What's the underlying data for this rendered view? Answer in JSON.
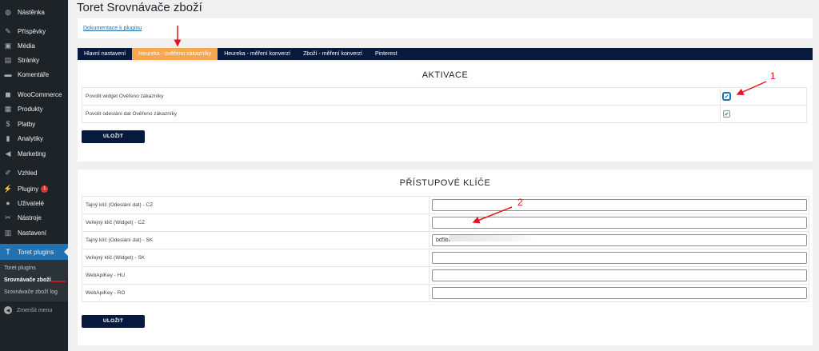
{
  "sidebar": {
    "items": [
      {
        "label": "Nástěnka",
        "icon": "dashboard-icon",
        "glyph": "◍"
      },
      {
        "label": "Příspěvky",
        "icon": "pin-icon",
        "glyph": "✎"
      },
      {
        "label": "Média",
        "icon": "media-icon",
        "glyph": "▣"
      },
      {
        "label": "Stránky",
        "icon": "pages-icon",
        "glyph": "▤"
      },
      {
        "label": "Komentáře",
        "icon": "comments-icon",
        "glyph": "▬"
      },
      {
        "label": "WooCommerce",
        "icon": "woocommerce-icon",
        "glyph": "◼"
      },
      {
        "label": "Produkty",
        "icon": "products-icon",
        "glyph": "▦"
      },
      {
        "label": "Platby",
        "icon": "payments-icon",
        "glyph": "$"
      },
      {
        "label": "Analytiky",
        "icon": "analytics-icon",
        "glyph": "▮"
      },
      {
        "label": "Marketing",
        "icon": "marketing-icon",
        "glyph": "◀"
      },
      {
        "label": "Vzhled",
        "icon": "appearance-icon",
        "glyph": "✐"
      },
      {
        "label": "Pluginy",
        "icon": "plugins-icon",
        "glyph": "⚡",
        "badge": "1"
      },
      {
        "label": "Uživatelé",
        "icon": "users-icon",
        "glyph": "●"
      },
      {
        "label": "Nástroje",
        "icon": "tools-icon",
        "glyph": "✂"
      },
      {
        "label": "Nastavení",
        "icon": "settings-icon",
        "glyph": "▥"
      },
      {
        "label": "Toret plugins",
        "icon": "toret-icon",
        "glyph": "T"
      }
    ],
    "submenu": [
      "Toret plugins",
      "Srovnávače zboží",
      "Srovnávače zboží log"
    ],
    "collapse": "Zmenšit menu"
  },
  "page": {
    "title": "Toret Srovnávače zboží",
    "doc_link": "Dokumentace k pluginu"
  },
  "tabs": [
    "Hlavní nastavení",
    "Heureka - ověřeno zákazníky",
    "Heureka - měření konverzí",
    "Zboží - měření konverzí",
    "Pinterest"
  ],
  "activation": {
    "title": "AKTIVACE",
    "rows": [
      {
        "label": "Povolit widget Ověřeno zákazníky",
        "checked": true
      },
      {
        "label": "Povolit odeslání dat Ověřeno zákazníky",
        "checked": true
      }
    ],
    "save": "ULOŽIT"
  },
  "keys": {
    "title": "PŘÍSTUPOVÉ KLÍČE",
    "rows": [
      {
        "label": "Tajný klíč (Odeslání dat) - CZ",
        "value": ""
      },
      {
        "label": "Veřejný klíč (Widget) - CZ",
        "value": ""
      },
      {
        "label": "Tajný klíč (Odeslání dat) - SK",
        "value": "bd5bc"
      },
      {
        "label": "Veřejný klíč (Widget) - SK",
        "value": ""
      },
      {
        "label": "WebApiKey - HU",
        "value": ""
      },
      {
        "label": "WebApiKey - RO",
        "value": ""
      }
    ],
    "save": "ULOŽIT"
  },
  "annotations": [
    "1",
    "2"
  ],
  "colors": {
    "accent": "#f4a84f",
    "navy": "#071a3e",
    "wp_blue": "#2271b1",
    "arrow": "#e3161d"
  }
}
